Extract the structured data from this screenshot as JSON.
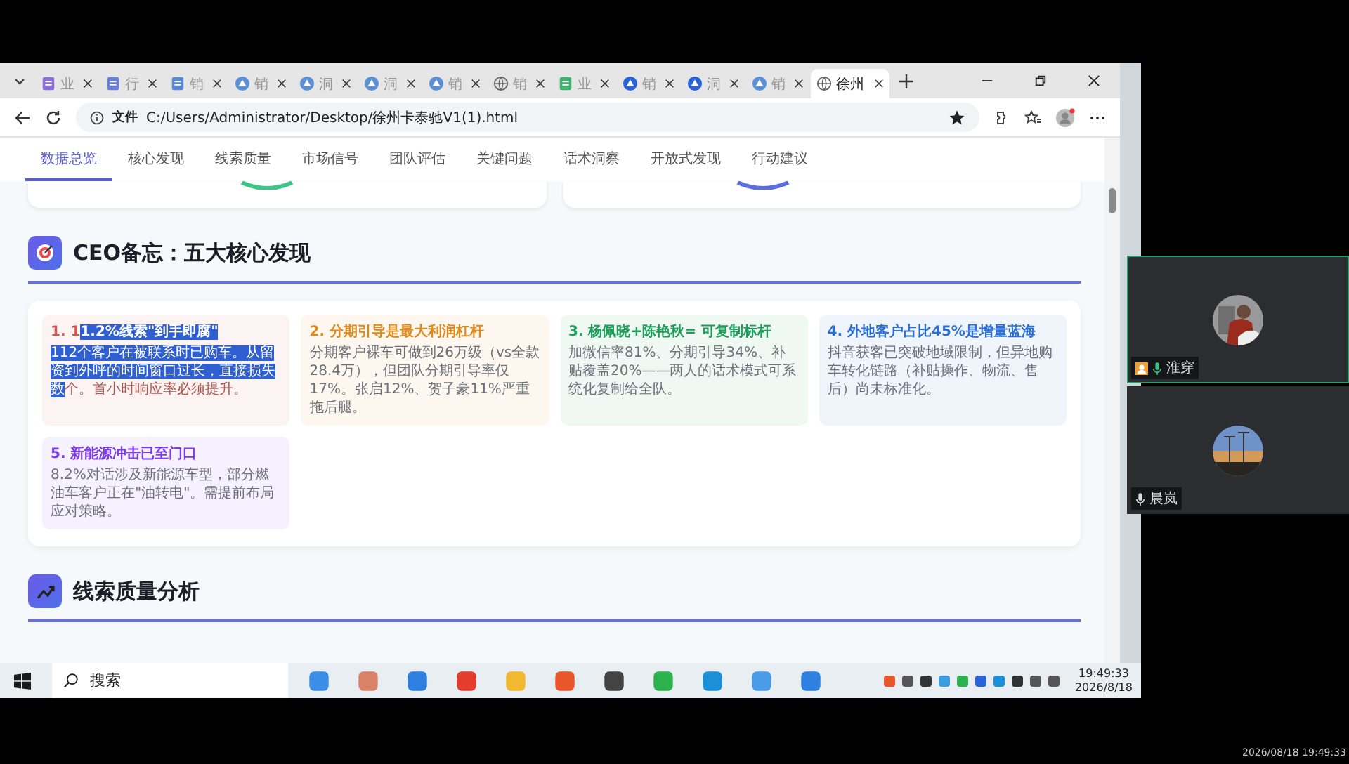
{
  "browser": {
    "tabs": [
      {
        "title": "业",
        "kind": "doc",
        "selected": false
      },
      {
        "title": "行",
        "kind": "slides",
        "selected": false
      },
      {
        "title": "销",
        "kind": "sheet",
        "selected": false
      },
      {
        "title": "销",
        "kind": "web",
        "selected": false
      },
      {
        "title": "洞",
        "kind": "web",
        "selected": false
      },
      {
        "title": "洞",
        "kind": "web",
        "selected": false
      },
      {
        "title": "销",
        "kind": "web",
        "selected": false
      },
      {
        "title": "销",
        "kind": "globe",
        "selected": false
      },
      {
        "title": "业",
        "kind": "green",
        "selected": false
      },
      {
        "title": "销",
        "kind": "app",
        "selected": false
      },
      {
        "title": "洞",
        "kind": "app",
        "selected": false
      },
      {
        "title": "销",
        "kind": "web",
        "selected": false
      },
      {
        "title": "徐州",
        "kind": "globe",
        "selected": true
      }
    ],
    "address": {
      "scheme": "文件",
      "url": "C:/Users/Administrator/Desktop/徐州卡泰驰V1(1).html"
    }
  },
  "page": {
    "nav": [
      {
        "label": "数据总览",
        "selected": true
      },
      {
        "label": "核心发现",
        "selected": false
      },
      {
        "label": "线索质量",
        "selected": false
      },
      {
        "label": "市场信号",
        "selected": false
      },
      {
        "label": "团队评估",
        "selected": false
      },
      {
        "label": "关键问题",
        "selected": false
      },
      {
        "label": "话术洞察",
        "selected": false
      },
      {
        "label": "开放式发现",
        "selected": false
      },
      {
        "label": "行动建议",
        "selected": false
      }
    ],
    "sections": [
      {
        "title": "CEO备忘：五大核心发现",
        "kind": "target"
      },
      {
        "title": "线索质量分析",
        "kind": "chart"
      }
    ],
    "findings": [
      {
        "color": "#d9534f",
        "title": [
          {
            "text": "1. 1",
            "selected": false
          },
          {
            "text": "1.2%线索\"到手即腐\"",
            "selected": true
          }
        ],
        "body": [
          {
            "text": "112个客户在被联系时已购车。从留资到外呼的时间窗口过长，直接损失数",
            "selected": true
          },
          {
            "text": "个。首小时响应率必须提升。",
            "selected": false
          }
        ]
      },
      {
        "color": "#e08a1e",
        "title": [
          {
            "text": "2. 分期引导是最大利润杠杆",
            "selected": false
          }
        ],
        "body": [
          {
            "text": "分期客户裸车可做到26万级（vs全款28.4万），但团队分期引导率仅17%。张启12%、贺子豪11%严重拖后腿。",
            "selected": false
          }
        ]
      },
      {
        "color": "#1f9d5a",
        "title": [
          {
            "text": "3. 杨佩晓+陈艳秋= 可复制标杆",
            "selected": false
          }
        ],
        "body": [
          {
            "text": "加微信率81%、分期引导34%、补贴覆盖20%——两人的话术模式可系统化复制给全队。",
            "selected": false
          }
        ]
      },
      {
        "color": "#2b6fd6",
        "title": [
          {
            "text": "4. 外地客户占比45%是增量蓝海",
            "selected": false
          }
        ],
        "body": [
          {
            "text": "抖音获客已突破地域限制，但异地购车转化链路（补贴操作、物流、售后）尚未标准化。",
            "selected": false
          }
        ]
      },
      {
        "color": "#7c3aed",
        "title": [
          {
            "text": "5. 新能源冲击已至门口",
            "selected": false
          }
        ],
        "body": [
          {
            "text": "8.2%对话涉及新能源车型，部分燃油车客户正在\"油转电\"。需提前布局应对策略。",
            "selected": false
          }
        ]
      }
    ]
  },
  "taskbar": {
    "search_placeholder": "搜索",
    "time": "19:49:33",
    "date": "2026/8/18"
  },
  "meeting": {
    "participants": [
      {
        "name": "淮穿",
        "speaking": true,
        "kind": "person"
      },
      {
        "name": "晨岚",
        "speaking": false,
        "kind": "sunset"
      }
    ]
  },
  "recording_timestamp": "2026/08/18 19:49:33"
}
